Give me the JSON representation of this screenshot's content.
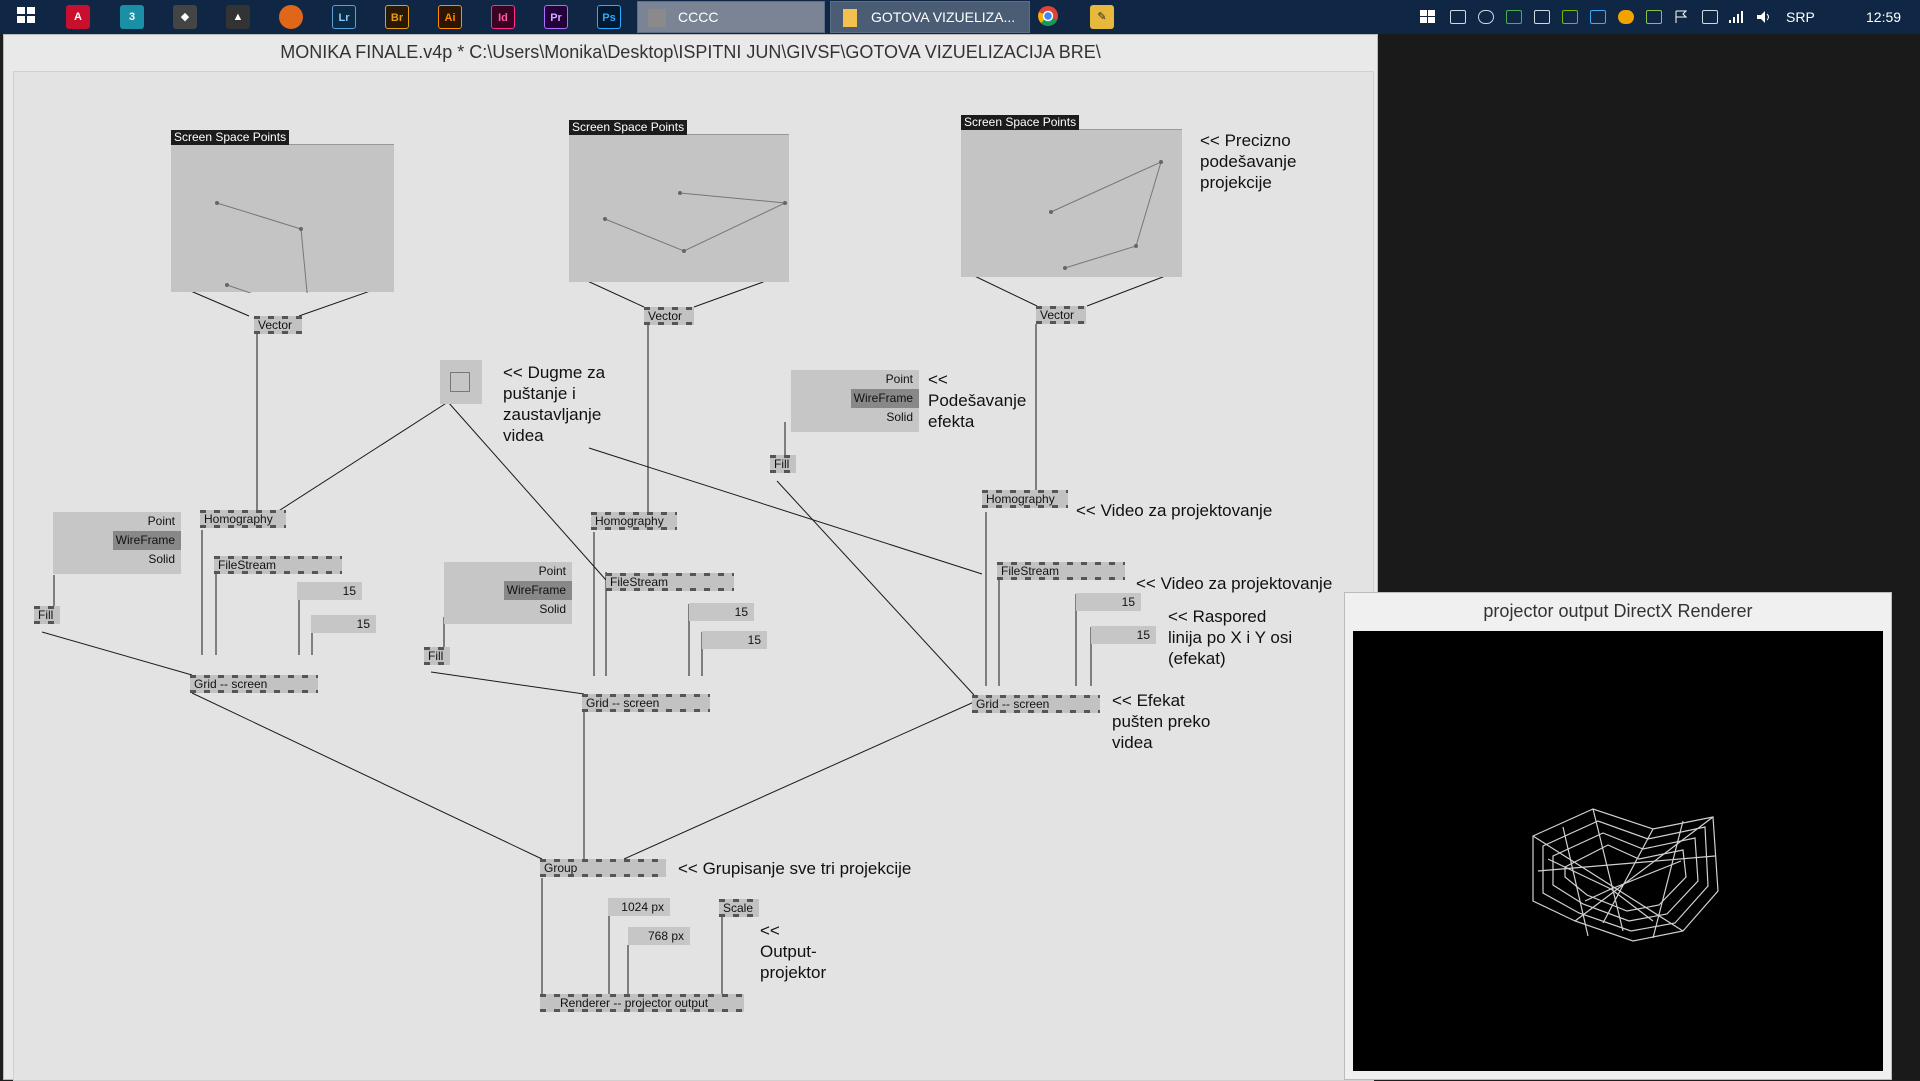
{
  "taskbar": {
    "icons": [
      "windows-start-icon",
      "autocad-icon",
      "3dsmax-icon",
      "unity-icon",
      "inkscape-icon",
      "firefox-icon",
      "lightroom-icon",
      "bridge-icon",
      "illustrator-icon",
      "indesign-icon",
      "premiere-icon",
      "photoshop-icon"
    ],
    "icon_labels": {
      "lr": "Lr",
      "br": "Br",
      "ai": "Ai",
      "id": "Id",
      "pr": "Pr",
      "ps": "Ps"
    },
    "tasks": [
      {
        "label": "CCCC"
      },
      {
        "label": "GOTOVA VIZUELIZA..."
      }
    ],
    "language": "SRP",
    "clock": "12:59"
  },
  "patch": {
    "title": "MONIKA FINALE.v4p *  C:\\Users\\Monika\\Desktop\\ISPITNI JUN\\GIVSF\\GOTOVA VIZUELIZACIJA BRE\\",
    "ssp_label": "Screen Space Points",
    "node_labels": {
      "vector": "Vector",
      "homography": "Homography",
      "filestream": "FileStream",
      "grid": "Grid  --  screen",
      "fill": "Fill",
      "group": "Group",
      "renderer": "Renderer  --  projector output",
      "scale": "Scale"
    },
    "enum_items": [
      "Point",
      "WireFrame",
      "Solid"
    ],
    "enum_selected": "WireFrame",
    "io_values": {
      "v15": "15",
      "width": "1024 px",
      "height": "768 px"
    },
    "comments": {
      "precision": "<< Precizno\npodešavanje\nprojekcije",
      "buttons": "<< Dugme za\npuštanje i\nzaustavljanje\nvidea",
      "effects": "<<\nPodešavanje\nefekta",
      "video1": "<< Video za projektovanje",
      "video2": "<< Video za projektovanje",
      "lines": "<< Raspored\nlinija po X i Y osi\n(efekat)",
      "effect_over": "<< Efekat\npušten preko\nvidea",
      "group": "<< Grupisanje sve tri projekcije",
      "output": "<<\nOutput-\nprojektor"
    }
  },
  "renderer_window": {
    "title": "projector output   DirectX Renderer"
  },
  "colors": {
    "taskbar": "#0f2744",
    "canvas": "#e3e3e3",
    "node": "#c2c2c2",
    "wire": "#1a1a1a"
  }
}
